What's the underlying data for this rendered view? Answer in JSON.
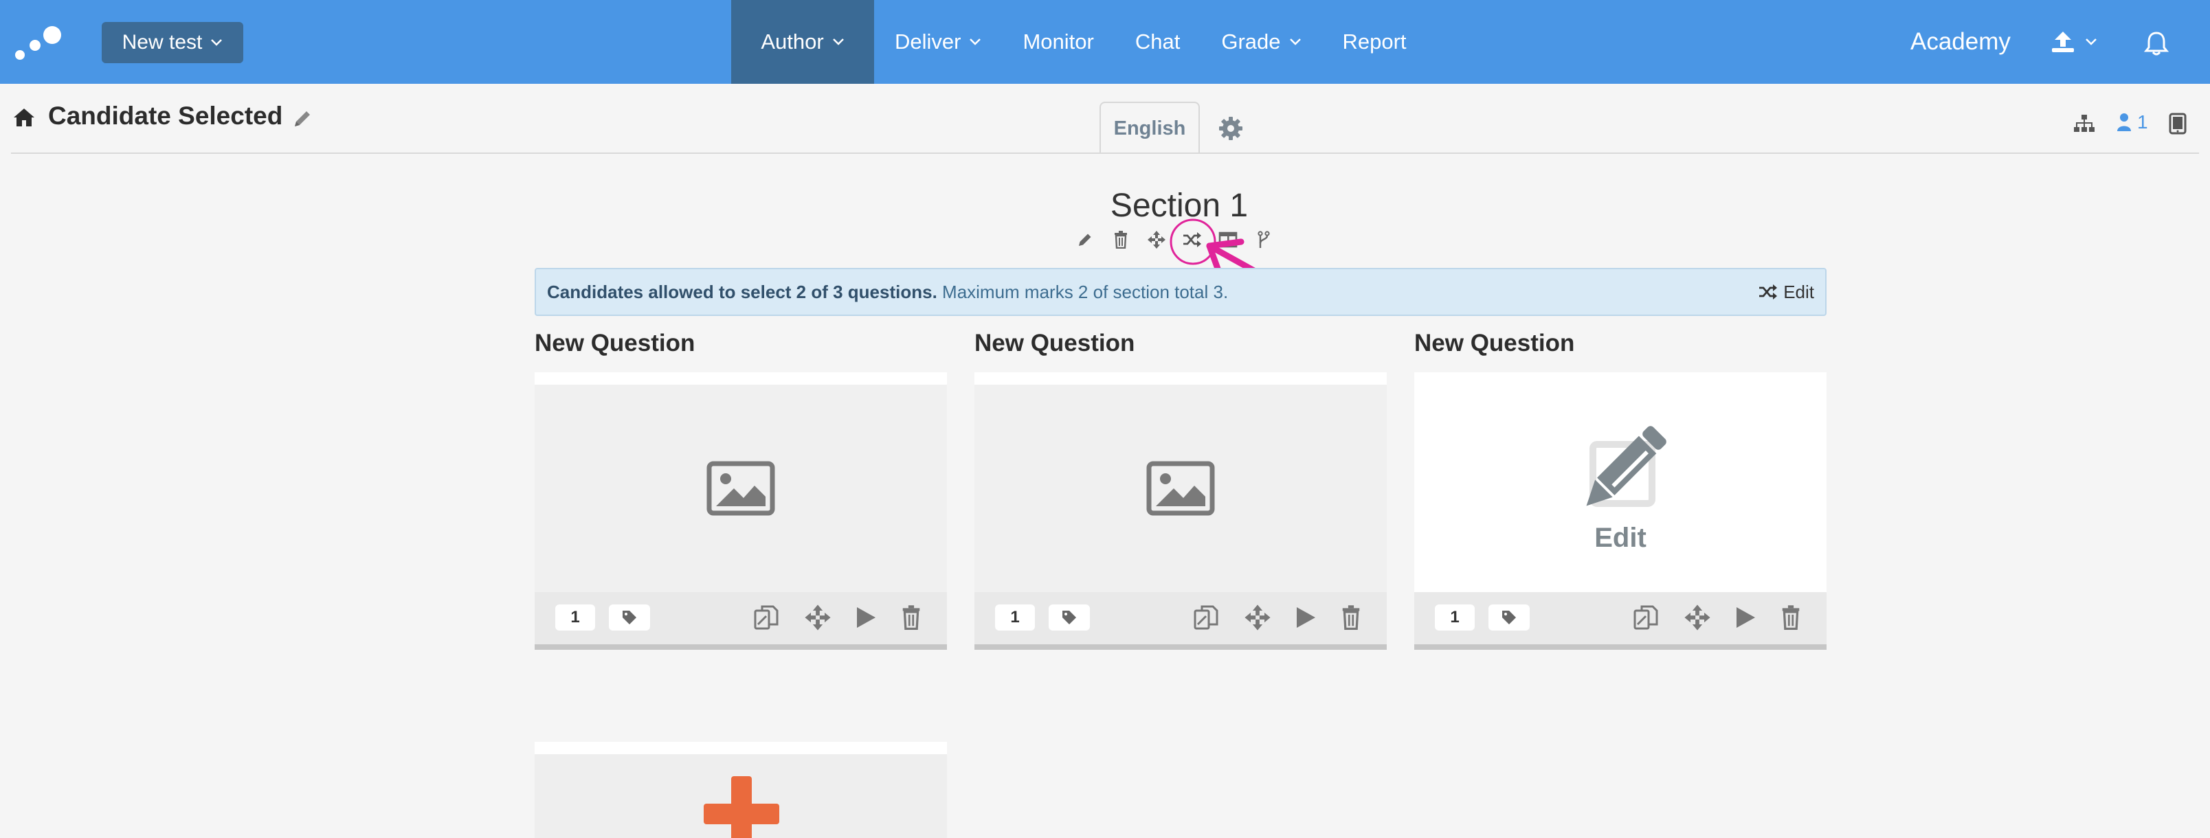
{
  "topbar": {
    "new_test_label": "New test",
    "nav": [
      {
        "label": "Author",
        "dropdown": true,
        "active": true
      },
      {
        "label": "Deliver",
        "dropdown": true
      },
      {
        "label": "Monitor"
      },
      {
        "label": "Chat"
      },
      {
        "label": "Grade",
        "dropdown": true
      },
      {
        "label": "Report"
      }
    ],
    "org_name": "Academy"
  },
  "header": {
    "title": "Candidate Selected",
    "language_tab": "English",
    "user_count": "1"
  },
  "section": {
    "title": "Section 1",
    "tools": [
      "pencil-icon",
      "trash-icon",
      "move-icon",
      "shuffle-icon",
      "columns-icon",
      "branch-icon"
    ],
    "info_bold": "Candidates allowed to select 2 of 3 questions.",
    "info_rest": " Maximum marks 2 of section total 3.",
    "info_edit_label": "Edit"
  },
  "questions": [
    {
      "title": "New Question",
      "marks": "1",
      "thumb": "image-placeholder-icon"
    },
    {
      "title": "New Question",
      "marks": "1",
      "thumb": "image-placeholder-icon"
    },
    {
      "title": "New Question",
      "marks": "1",
      "thumb": "edit-pencil-icon",
      "thumb_label": "Edit"
    }
  ],
  "colors": {
    "topbar": "#4a96e5",
    "active_nav": "#3a6a95",
    "info_bg": "#d9eaf6",
    "annotation": "#e0249a",
    "add_accent": "#ea6a3d"
  }
}
